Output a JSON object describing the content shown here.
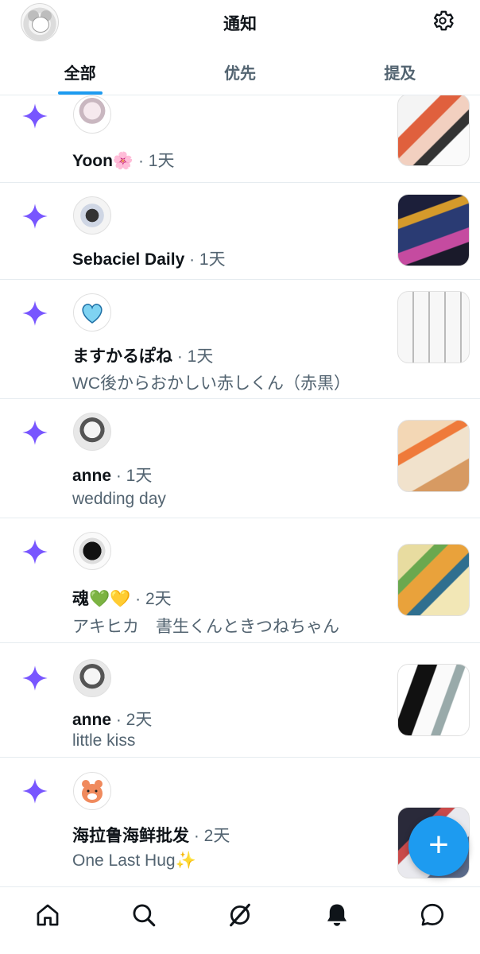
{
  "header": {
    "title": "通知"
  },
  "tabs": [
    {
      "label": "全部",
      "active": true
    },
    {
      "label": "优先",
      "active": false
    },
    {
      "label": "提及",
      "active": false
    }
  ],
  "notifications": [
    {
      "name": "Yoon🌸",
      "meta": "· 1天",
      "text": ""
    },
    {
      "name": "Sebaciel Daily",
      "meta": "· 1天",
      "text": ""
    },
    {
      "name": "ますかるぽね",
      "meta": "· 1天",
      "text": "WC後からおかしい赤しくん（赤黒）"
    },
    {
      "name": "anne",
      "meta": "· 1天",
      "text": "wedding day"
    },
    {
      "name": "魂💚💛",
      "meta": "· 2天",
      "text": "アキヒカ　書生くんときつねちゃん"
    },
    {
      "name": "anne",
      "meta": "· 2天",
      "text": "little kiss"
    },
    {
      "name": "海拉鲁海鲜批发",
      "meta": "· 2天",
      "text": "One Last Hug✨"
    }
  ],
  "fab": {
    "label": "+"
  },
  "colors": {
    "accent": "#1d9bf0",
    "sparkle": "#7856ff",
    "secondary_text": "#536471",
    "divider": "#e6ecf0"
  },
  "icons": {
    "header_right": "gear-icon",
    "notification_type": "sparkle-icon",
    "nav": [
      "home-icon",
      "search-icon",
      "grok-icon",
      "bell-icon",
      "chat-icon"
    ]
  }
}
